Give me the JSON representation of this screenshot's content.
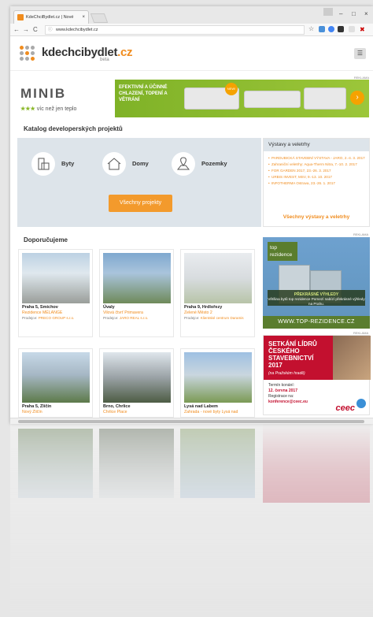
{
  "browser": {
    "tab_title": "KdeChciBydlet.cz | Nové",
    "tab_close": "×",
    "url": "www.kdechcibydlet.cz",
    "controls": {
      "minimize": "–",
      "maximize": "□",
      "close": "×"
    }
  },
  "header": {
    "logo_text": "kdechcibydlet",
    "logo_tld": ".cz",
    "logo_beta": "beta",
    "menu_icon": "hamburger-icon"
  },
  "ad_banner": {
    "label": "REKLAMA",
    "brand": "MINIB",
    "slogan_stars": "★★★",
    "slogan": "víc než jen teplo",
    "headline": "EFEKTIVNÍ A ÚČINNÉ CHLAZENÍ, TOPENÍ A VĚTRÁNÍ",
    "badge": "NEW!"
  },
  "catalog": {
    "title": "Katalog developerských projektů",
    "categories": [
      {
        "label": "Byty",
        "icon": "apartment-icon"
      },
      {
        "label": "Domy",
        "icon": "house-icon"
      },
      {
        "label": "Pozemky",
        "icon": "land-icon"
      }
    ],
    "all_button": "Všechny projekty"
  },
  "fairs": {
    "title": "Výstavy a veletrhy",
    "items": [
      "PARDUBICKÁ STAVEBNÍ VÝSTAVA - JARO, 2.-4. 3. 2017",
      "Zahraniční veletrhy: Aqua-Therm Nitra, 7.-10. 2. 2017",
      "FOR GARDEN 2017, 23.-26. 3. 2017",
      "URBIS INVEST, MSV, 9.-13. 10. 2017",
      "INFOTHERMA Ostrava, 23.-26. 1. 2017"
    ],
    "all_link": "Všechny výstavy a veletrhy"
  },
  "recommended": {
    "title": "Doporučujeme",
    "cards": [
      {
        "city": "Praha 5, Smíchov",
        "name": "Rezidence MÉLANGE",
        "dev_label": "Prodejce:",
        "developer": "PRECO GROUP s.r.o."
      },
      {
        "city": "Úvaly",
        "name": "Vilová čtvrť Primavera",
        "dev_label": "Prodejce:",
        "developer": "JARO REAL s.r.o."
      },
      {
        "city": "Praha 9, Hrdlořezy",
        "name": "Zelené Město 2",
        "dev_label": "Prodejce:",
        "developer": "Klientské centrum Daramis"
      },
      {
        "city": "Praha 5, Zličín",
        "name": "Nový Zličín",
        "dev_label": "",
        "developer": ""
      },
      {
        "city": "Brno, Chrlice",
        "name": "Chrlice Place",
        "dev_label": "",
        "developer": ""
      },
      {
        "city": "Lysá nad Labem",
        "name": "Zahrada - nové byty Lysá nad",
        "dev_label": "",
        "developer": ""
      }
    ]
  },
  "side_ads": {
    "top": {
      "label": "REKLAMA",
      "brand": "top rezidence",
      "tagline": "PŘEKRÁSNÉ VÝHLEDY",
      "text": "Většina bytů top rezidence Pomezí nabízí překrásné výhledy na Prahu.",
      "url": "WWW.TOP-REZIDENCE.CZ"
    },
    "ceec": {
      "label": "REKLAMA",
      "title": "SETKÁNÍ LÍDRŮ ČESKÉHO STAVEBNICTVÍ 2017",
      "subtitle": "(na Pražském hradě)",
      "date_label": "Termín konání:",
      "date": "12. června 2017",
      "reg_label": "Registrace na:",
      "reg": "konference@ceec.eu",
      "logo": "ceec"
    }
  },
  "colors": {
    "accent": "#f08c1e",
    "button": "#f39a2c",
    "panel": "#dde4ea",
    "ad_green": "#8bb82a",
    "ceec_red": "#c3102f"
  }
}
